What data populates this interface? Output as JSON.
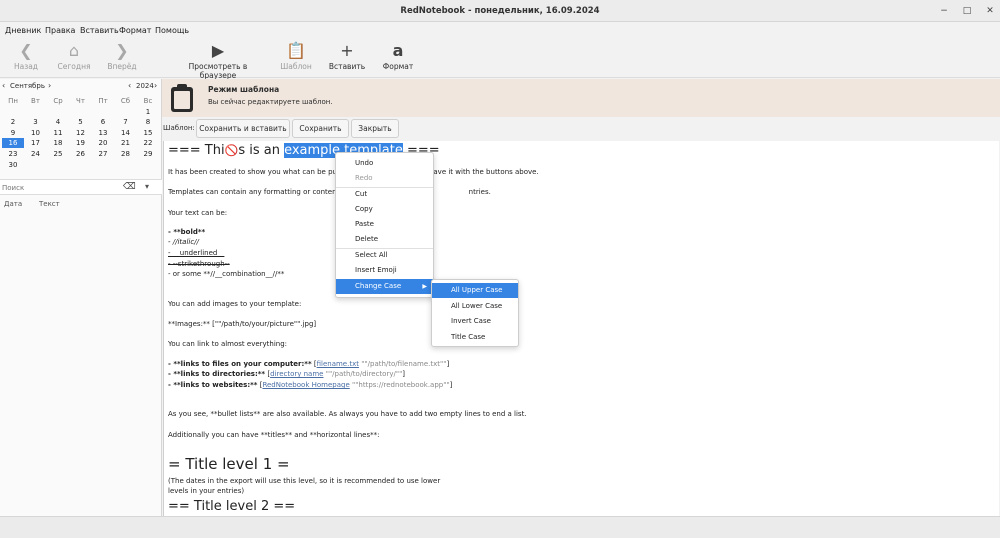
{
  "window": {
    "title": "RedNotebook - понедельник, 16.09.2024"
  },
  "menubar": [
    "Дневник",
    "Правка",
    "Вставить",
    "Формат",
    "Помощь"
  ],
  "toolbar": {
    "back": "Назад",
    "today": "Сегодня",
    "forward": "Вперёд",
    "preview": "Просмотреть в браузере",
    "template": "Шаблон",
    "insert": "Вставить",
    "format": "Формат"
  },
  "calendar": {
    "month": "Сентябрь",
    "year": "2024",
    "weekdays": [
      "Пн",
      "Вт",
      "Ср",
      "Чт",
      "Пт",
      "Сб",
      "Вс"
    ],
    "weeks": [
      [
        "",
        "",
        "",
        "",
        "",
        "",
        "1"
      ],
      [
        "2",
        "3",
        "4",
        "5",
        "6",
        "7",
        "8"
      ],
      [
        "9",
        "10",
        "11",
        "12",
        "13",
        "14",
        "15"
      ],
      [
        "16",
        "17",
        "18",
        "19",
        "20",
        "21",
        "22"
      ],
      [
        "23",
        "24",
        "25",
        "26",
        "27",
        "28",
        "29"
      ],
      [
        "30",
        "",
        "",
        "",
        "",
        "",
        ""
      ]
    ],
    "selected": "16"
  },
  "search": {
    "placeholder": "Поиск"
  },
  "results": {
    "col_date": "Дата",
    "col_text": "Текст"
  },
  "banner": {
    "title": "Режим шаблона",
    "subtitle": "Вы сейчас редактируете шаблон."
  },
  "template_bar": {
    "label": "Шаблон:",
    "save_insert": "Сохранить и вставить",
    "save": "Сохранить",
    "close": "Закрыть"
  },
  "editor": {
    "heading_pre": "=== Thi",
    "heading_mid": "s is an ",
    "heading_sel": "example template",
    "heading_post": " ===",
    "line_intro_a": "It has been created to show you what can be put int",
    "line_intro_b": "d save it with the buttons above.",
    "line_templates_a": "Templates can contain any formatting or content th",
    "line_templates_b": "ntries.",
    "line_can_be": "Your text can be:",
    "bold": "- **bold**",
    "italic": "- //italic//",
    "underlined": "- __underlined__",
    "strike": "- --strikethrough--",
    "combo": "- or some **//__combination__//**",
    "images_intro": "You can add images to your template:",
    "images_line": "**Images:** [\"\"/path/to/your/picture\"\".jpg]",
    "links_intro": "You can link to almost everything:",
    "link_files_label": "- **links to files on your computer:**",
    "link_files_text": "filename.txt",
    "link_files_path": "\"\"/path/to/filename.txt\"\"",
    "link_dirs_label": "- **links to directories:**",
    "link_dirs_text": "directory name",
    "link_dirs_path": "\"\"/path/to/directory/\"\"",
    "link_web_label": "- **links to websites:**",
    "link_web_text": "RedNotebook Homepage",
    "link_web_path": "\"\"https://rednotebook.app\"\"",
    "bullets": "As you see, **bullet lists** are also available. As always you have to add two empty lines to end a list.",
    "titles": "Additionally you can have **titles** and **horizontal lines**:",
    "title1": "= Title level 1 =",
    "title1_note_a": "(The dates in the export will use this level, so it is recommended to use lower",
    "title1_note_b": "levels in your entries)",
    "title2": "== Title level 2 =="
  },
  "context_menu": {
    "items": [
      "Undo",
      "Redo",
      "Cut",
      "Copy",
      "Paste",
      "Delete",
      "Select All",
      "Insert Emoji",
      "Change Case"
    ],
    "disabled": [
      "Redo"
    ],
    "active": "Change Case"
  },
  "submenu": {
    "items": [
      "All Upper Case",
      "All Lower Case",
      "Invert Case",
      "Title Case"
    ],
    "active": "All Upper Case"
  },
  "colors": {
    "accent": "#3584e4",
    "banner": "#f0e6dd",
    "link": "#4a6fa5"
  }
}
